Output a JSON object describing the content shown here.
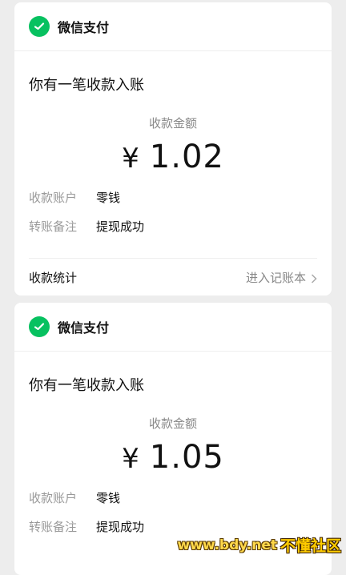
{
  "accent_color": "#07c160",
  "cards": [
    {
      "app_name": "微信支付",
      "title": "你有一笔收款入账",
      "amount_label": "收款金额",
      "currency": "¥",
      "amount": "1.02",
      "details": [
        {
          "key": "收款账户",
          "value": "零钱"
        },
        {
          "key": "转账备注",
          "value": "提现成功"
        }
      ],
      "footer_left": "收款统计",
      "footer_right": "进入记账本"
    },
    {
      "app_name": "微信支付",
      "title": "你有一笔收款入账",
      "amount_label": "收款金额",
      "currency": "¥",
      "amount": "1.05",
      "details": [
        {
          "key": "收款账户",
          "value": "零钱"
        },
        {
          "key": "转账备注",
          "value": "提现成功"
        }
      ]
    }
  ],
  "watermark": {
    "url": "www.bdy.net",
    "name": "不懂社区"
  }
}
